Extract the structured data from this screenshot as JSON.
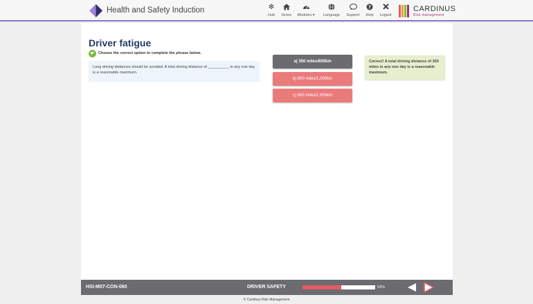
{
  "header": {
    "app_title": "Health and Safety Induction",
    "nav": [
      {
        "label": "Hub",
        "icon": "hub-icon"
      },
      {
        "label": "Home",
        "icon": "home-icon"
      },
      {
        "label": "Modules ▾",
        "icon": "modules-icon"
      },
      {
        "label": "Language",
        "icon": "globe-icon"
      },
      {
        "label": "Support",
        "icon": "chat-icon"
      },
      {
        "label": "Help",
        "icon": "help-icon"
      },
      {
        "label": "Logout",
        "icon": "close-icon"
      }
    ],
    "brand": {
      "name": "CARDINUS",
      "sub": "Risk management"
    }
  },
  "main": {
    "title": "Driver fatigue",
    "instruction": "Choose the correct option to complete the phrase below.",
    "question": "Long driving distances should be avoided. A total driving distance of __________ in any one day is a reasonable maximum.",
    "options": [
      {
        "label": "a) 350 miles/600km",
        "state": "selected"
      },
      {
        "label": "b) 600 miles/1,000km",
        "state": "wrong"
      },
      {
        "label": "c) 900 miles/1,500km",
        "state": "wrong"
      }
    ],
    "feedback": "Correct! A total driving distance of 350 miles in any one day is a reasonable maximum."
  },
  "footer": {
    "code": "HSI-M07-CON-060",
    "section": "DRIVER SAFETY",
    "progress_fraction": 0.53,
    "progress_label": "53%"
  },
  "copyright": "© Cardinus Risk Management",
  "colors": {
    "accent_purple": "#8a77c9",
    "title_navy": "#243a68",
    "selected_option": "#6b6b70",
    "wrong_option": "#ea7b7b",
    "feedback_bg": "#e6efce",
    "progress_fill": "#e35b63",
    "next_arrow": "#e35b63"
  }
}
